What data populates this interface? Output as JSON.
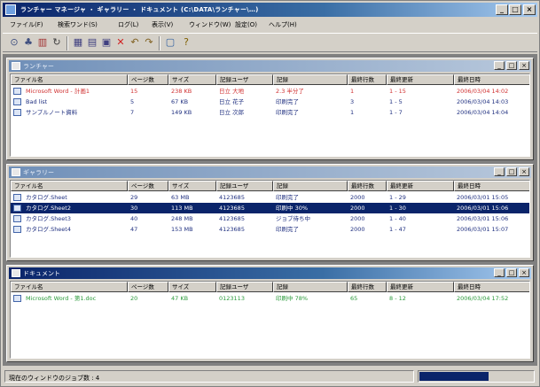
{
  "app": {
    "title": "ランチャー マネージャ ・ ギャラリー ・ ドキュメント (C:\\DATA\\ランチャー\\…)"
  },
  "menu": [
    "ファイル(F)",
    "検索ワンド(S)",
    "ログ(L)",
    "表示(V)",
    "ウィンドウ(W)",
    "設定(O)",
    "ヘルプ(H)"
  ],
  "toolbar_icons": [
    "open-icon",
    "print-icon",
    "book-icon",
    "refresh-icon",
    "grid-icon",
    "export-icon",
    "document-icon",
    "delete-icon",
    "undo-icon",
    "redo-icon",
    "window-icon",
    "help-icon"
  ],
  "columns": [
    "ファイル名",
    "ページ数",
    "サイズ",
    "記録ユーザ",
    "記録",
    "最終行数",
    "最終更新",
    "最終日時"
  ],
  "windows": [
    {
      "title": "ランチャー",
      "rows": [
        {
          "name": "Microsoft Word - 計画1",
          "pages": "15",
          "size": "238 KB",
          "user": "日立 大地",
          "record": "2.3 半分了",
          "lines": "1",
          "updated": "1 - 15",
          "date": "2006/03/04 14:02",
          "color": "#d03030"
        },
        {
          "name": "Bad list",
          "pages": "5",
          "size": "67 KB",
          "user": "日立 花子",
          "record": "印刷完了",
          "lines": "3",
          "updated": "1 - 5",
          "date": "2006/03/04 14:03",
          "color": "#203080"
        },
        {
          "name": "サンプルノート資料",
          "pages": "7",
          "size": "149 KB",
          "user": "日立 次郎",
          "record": "印刷完了",
          "lines": "1",
          "updated": "1 - 7",
          "date": "2006/03/04 14:04",
          "color": "#203080"
        }
      ]
    },
    {
      "title": "ギャラリー",
      "rows": [
        {
          "name": "カタログ.Sheet",
          "pages": "29",
          "size": "63 MB",
          "user": "4123685",
          "record": "印刷完了",
          "lines": "2000",
          "updated": "1 - 29",
          "date": "2006/03/01 15:05",
          "color": "#203080"
        },
        {
          "name": "カタログ.Sheet2",
          "pages": "30",
          "size": "113 MB",
          "user": "4123685",
          "record": "印刷中 30%",
          "lines": "2000",
          "updated": "1 - 30",
          "date": "2006/03/01 15:06",
          "color": "#ffffff"
        },
        {
          "name": "カタログ.Sheet3",
          "pages": "40",
          "size": "248 MB",
          "user": "4123685",
          "record": "ジョブ待ち中",
          "lines": "2000",
          "updated": "1 - 40",
          "date": "2006/03/01 15:06",
          "color": "#203080"
        },
        {
          "name": "カタログ.Sheet4",
          "pages": "47",
          "size": "153 MB",
          "user": "4123685",
          "record": "印刷完了",
          "lines": "2000",
          "updated": "1 - 47",
          "date": "2006/03/01 15:07",
          "color": "#203080"
        }
      ]
    },
    {
      "title": "ドキュメント",
      "rows": [
        {
          "name": "Microsoft Word - 第1.doc",
          "pages": "20",
          "size": "47 KB",
          "user": "0123113",
          "record": "印刷中 78%",
          "lines": "65",
          "updated": "8 - 12",
          "date": "2006/03/04 17:52",
          "color": "#2a9a3a"
        }
      ]
    }
  ],
  "status": {
    "text": "現在のウィンドウのジョブ数 : 4",
    "progress": 0.6
  },
  "colors": {
    "accent": "#0a246a",
    "selected_row": "#0a246a"
  }
}
